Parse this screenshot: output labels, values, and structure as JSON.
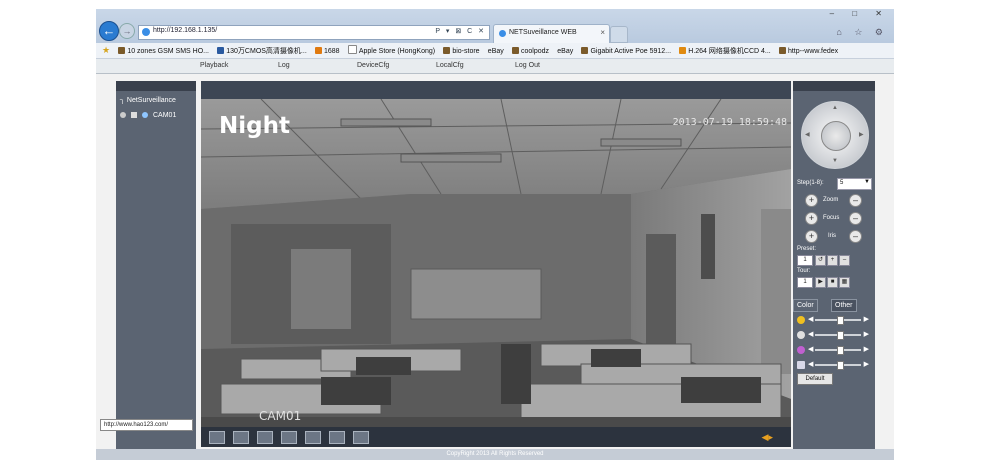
{
  "browser": {
    "url": "http://192.168.1.135/",
    "address_controls": "P ▾ ⊠ C ✕",
    "tab_title": "NETSuveillance WEB",
    "favorites": [
      "10 zones GSM SMS HO...",
      "130万CMOS高清摄像机...",
      "1688",
      "Apple Store (HongKong)",
      "bio-store",
      "eBay",
      "coolpodz",
      "eBay",
      "Gigabit Active Poe 5912...",
      "H.264 网络摄像机CCD 4...",
      "http--www.fedex"
    ]
  },
  "menu": [
    "Playback",
    "Log",
    "DeviceCfg",
    "LocalCfg",
    "Log Out"
  ],
  "left_panel": {
    "title": "NetSurveillance",
    "camera": "CAM01"
  },
  "video": {
    "overlay_label": "Night",
    "timestamp": "2013-07-19 18:59:48",
    "channel_label": "CAM01"
  },
  "ptz": {
    "step_label": "Step(1-8):",
    "step_value": "5",
    "zoom_label": "Zoom",
    "focus_label": "Focus",
    "iris_label": "Iris",
    "preset_label": "Preset:",
    "preset_value": "1",
    "tour_label": "Tour:",
    "tour_value": "1"
  },
  "color_tabs": [
    "Color",
    "Other"
  ],
  "color_sliders": [
    {
      "name": "brightness",
      "level": 0.55
    },
    {
      "name": "contrast",
      "level": 0.55
    },
    {
      "name": "saturation",
      "level": 0.55
    },
    {
      "name": "hue",
      "level": 0.55
    }
  ],
  "default_button": "Default",
  "status_link": "http://www.hao123.com/",
  "copyright": "CopyRight 2013 All Rights Reserved"
}
